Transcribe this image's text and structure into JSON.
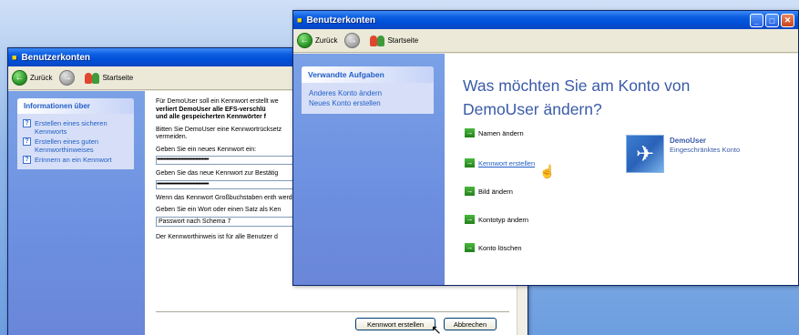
{
  "back_window": {
    "title": "Benutzerkonten",
    "toolbar": {
      "back": "Zurück",
      "home": "Startseite"
    },
    "info_panel": {
      "header": "Informationen über",
      "items": [
        "Erstellen eines sicheren Kennworts",
        "Erstellen eines guten Kennworthinweises",
        "Erinnern an ein Kennwort"
      ]
    },
    "content": {
      "intro_line1": "Für DemoUser soll ein Kennwort erstellt we",
      "intro_bold1": "verliert DemoUser alle EFS-verschlü",
      "intro_bold2": "und alle gespeicherten Kennwörter f",
      "reset_hint": "Bitten Sie DemoUser eine Kennwortrücksetz vermeiden.",
      "new_pw_label": "Geben Sie ein neues Kennwort ein:",
      "new_pw_value": "•••••••••••••••••••••••••••••••••••••••",
      "confirm_label": "Geben Sie das neue Kennwort zur Bestätig",
      "confirm_value": "•••••••••••••••••••••••••••••••••••••••",
      "caps_note": "Wenn das Kennwort Großbuchstaben enth werden.",
      "hint_label": "Geben Sie ein Wort oder einen Satz als Ken",
      "hint_value": "Passwort nach Schema 7",
      "hint_note": "Der Kennworthinweis ist für alle Benutzer d"
    },
    "buttons": {
      "create": "Kennwort erstellen",
      "cancel": "Abbrechen"
    }
  },
  "front_window": {
    "title": "Benutzerkonten",
    "toolbar": {
      "back": "Zurück",
      "home": "Startseite"
    },
    "related_tasks": {
      "header": "Verwandte Aufgaben",
      "items": [
        "Anderes Konto ändern",
        "Neues Konto erstellen"
      ]
    },
    "question": "Was möchten Sie am Konto von DemoUser ändern?",
    "actions": [
      "Namen ändern",
      "Kennwort erstellen",
      "Bild ändern",
      "Kontotyp ändern",
      "Konto löschen"
    ],
    "account": {
      "name": "DemoUser",
      "type": "Eingeschränktes Konto"
    }
  }
}
